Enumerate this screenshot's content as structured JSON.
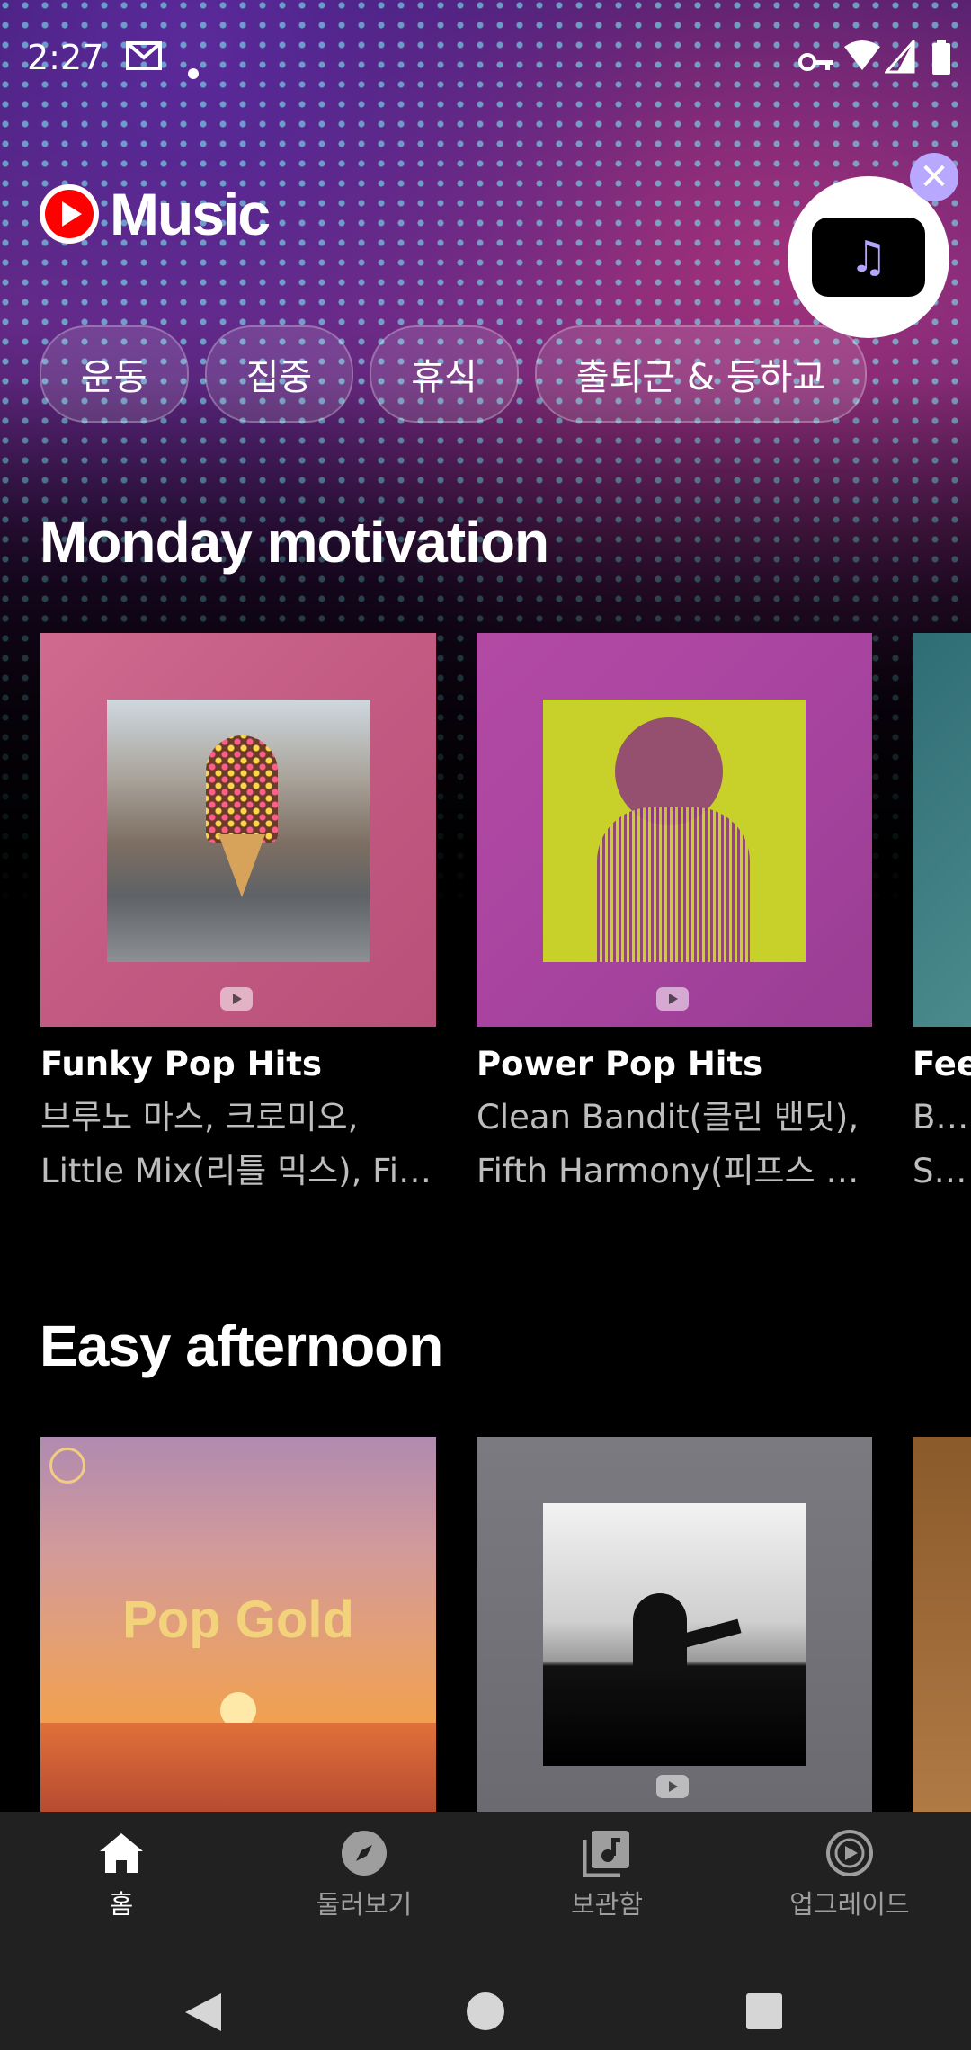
{
  "status_bar": {
    "time": "2:27"
  },
  "app": {
    "logo_text": "Music"
  },
  "chips": [
    "운동",
    "집중",
    "휴식",
    "출퇴근 & 등하교"
  ],
  "sections": [
    {
      "title": "Monday motivation",
      "cards": [
        {
          "title": "Funky Pop Hits",
          "sub1": "브루노 마스, 크로미오,",
          "sub2": "Little Mix(리틀 믹스), Fift..."
        },
        {
          "title": "Power Pop Hits",
          "sub1": "Clean Bandit(클린 밴딧),",
          "sub2": "Fifth Harmony(피프스 하..."
        },
        {
          "title": "Feel",
          "sub1": "Blac",
          "sub2": "Sug"
        }
      ]
    },
    {
      "title": "Easy afternoon",
      "cards": [
        {
          "overlay": "Pop Gold"
        },
        {},
        {}
      ]
    }
  ],
  "bottom_nav": [
    {
      "label": "홈",
      "icon": "home-icon"
    },
    {
      "label": "둘러보기",
      "icon": "compass-icon"
    },
    {
      "label": "보관함",
      "icon": "library-icon"
    },
    {
      "label": "업그레이드",
      "icon": "upgrade-icon"
    }
  ],
  "colors": {
    "accent": "#ff0000",
    "background": "#000000",
    "nav_background": "#212121"
  }
}
